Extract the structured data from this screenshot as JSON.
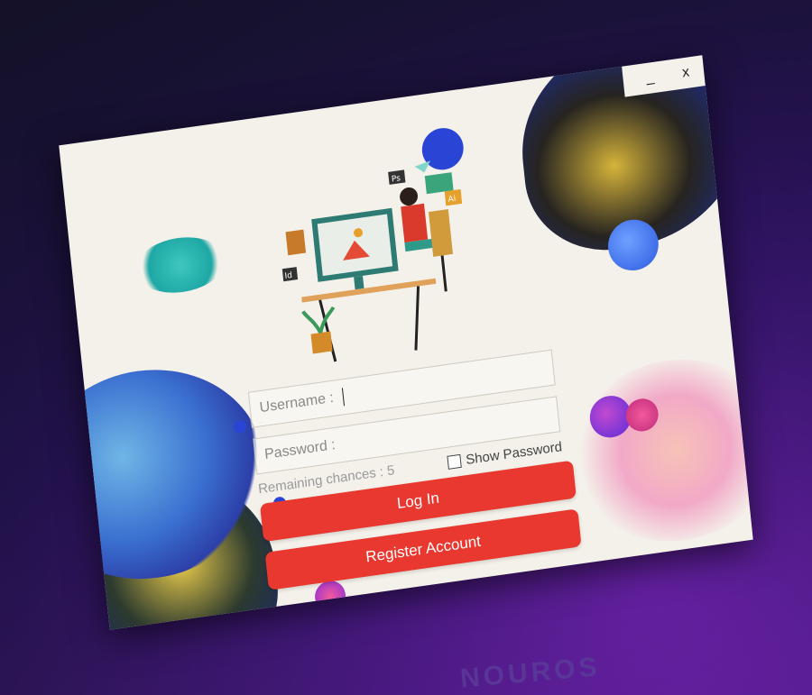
{
  "window": {
    "minimize_label": "_",
    "close_label": "x"
  },
  "login_form": {
    "username_label": "Username :",
    "username_value": "",
    "password_label": "Password :",
    "show_password_label": "Show Password",
    "show_password_checked": false,
    "remaining_label": "Remaining chances :",
    "remaining_count": "5",
    "login_button": "Log In",
    "register_button": "Register Account"
  },
  "illustration": {
    "badges": [
      "Ps",
      "Ai",
      "Id"
    ]
  },
  "bezel": {
    "brand_text": "NOUROS"
  },
  "colors": {
    "accent": "#e8382f",
    "background": "#f4f1ea"
  }
}
